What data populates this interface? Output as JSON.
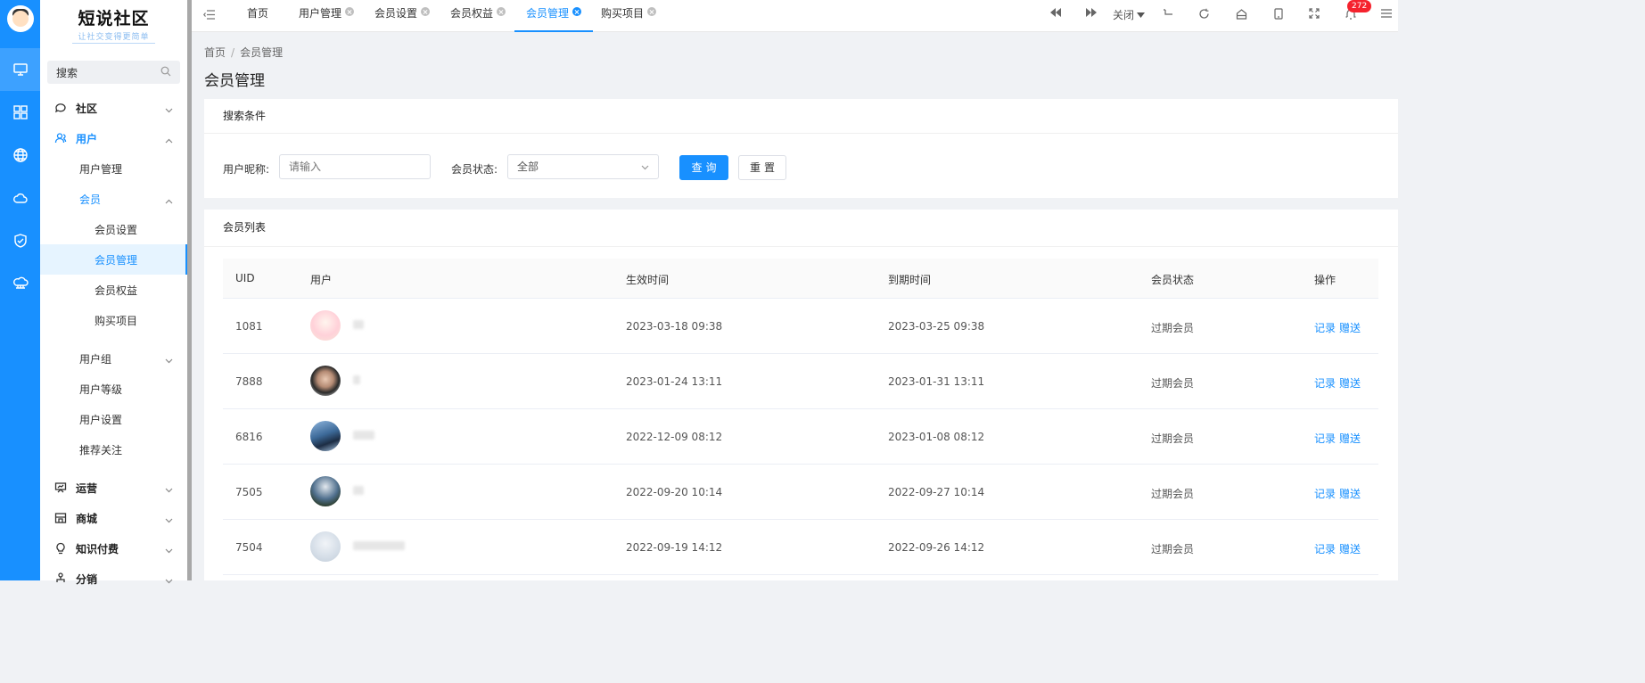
{
  "brand": {
    "title": "短说社区",
    "slogan": "让社交变得更简单"
  },
  "sidebar": {
    "search_placeholder": "搜索",
    "items": [
      {
        "label": "社区"
      },
      {
        "label": "用户"
      },
      {
        "label": "用户管理"
      },
      {
        "label": "会员"
      },
      {
        "label": "会员设置"
      },
      {
        "label": "会员管理"
      },
      {
        "label": "会员权益"
      },
      {
        "label": "购买项目"
      },
      {
        "label": "用户组"
      },
      {
        "label": "用户等级"
      },
      {
        "label": "用户设置"
      },
      {
        "label": "推荐关注"
      },
      {
        "label": "运营"
      },
      {
        "label": "商城"
      },
      {
        "label": "知识付费"
      },
      {
        "label": "分销"
      }
    ]
  },
  "tabs": [
    {
      "label": "首页"
    },
    {
      "label": "用户管理"
    },
    {
      "label": "会员设置"
    },
    {
      "label": "会员权益"
    },
    {
      "label": "会员管理"
    },
    {
      "label": "购买项目"
    }
  ],
  "toolbar": {
    "close_label": "关闭",
    "notification_count": "272"
  },
  "breadcrumb": {
    "home": "首页",
    "current": "会员管理"
  },
  "page_title": "会员管理",
  "search_card": {
    "title": "搜索条件",
    "nickname_label": "用户昵称:",
    "nickname_placeholder": "请输入",
    "status_label": "会员状态:",
    "status_value": "全部",
    "query_button": "查询",
    "reset_button": "重置"
  },
  "list_card": {
    "title": "会员列表",
    "columns": [
      "UID",
      "用户",
      "生效时间",
      "到期时间",
      "会员状态",
      "操作"
    ],
    "action_record": "记录",
    "action_gift": "赠送",
    "rows": [
      {
        "uid": "1081",
        "start": "2023-03-18 09:38",
        "end": "2023-03-25 09:38",
        "status": "过期会员"
      },
      {
        "uid": "7888",
        "start": "2023-01-24 13:11",
        "end": "2023-01-31 13:11",
        "status": "过期会员"
      },
      {
        "uid": "6816",
        "start": "2022-12-09 08:12",
        "end": "2023-01-08 08:12",
        "status": "过期会员"
      },
      {
        "uid": "7505",
        "start": "2022-09-20 10:14",
        "end": "2022-09-27 10:14",
        "status": "过期会员"
      },
      {
        "uid": "7504",
        "start": "2022-09-19 14:12",
        "end": "2022-09-26 14:12",
        "status": "过期会员"
      }
    ]
  },
  "colors": {
    "accent": "#1890ff",
    "rail": "#1890ff",
    "badge": "#f5222d"
  },
  "icons": {
    "rail": [
      "monitor-icon",
      "grid-icon",
      "globe-icon",
      "cloud-icon",
      "shield-check-icon",
      "cloud-network-icon"
    ],
    "toolbar": [
      "backward-icon",
      "forward-icon",
      "return-icon",
      "refresh-icon",
      "home-icon",
      "mobile-icon",
      "fullscreen-icon",
      "bell-icon",
      "menu-icon"
    ]
  }
}
